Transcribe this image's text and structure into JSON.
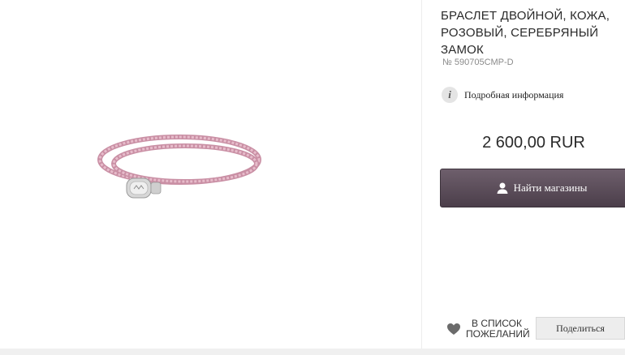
{
  "product": {
    "title": "БРАСЛЕТ ДВОЙНОЙ, КОЖА, РОЗОВЫЙ, СЕРЕБРЯНЫЙ ЗАМОК",
    "sku": "№ 590705CMP-D",
    "image_icon": "pink-double-leather-bracelet"
  },
  "details": {
    "icon": "info-icon",
    "icon_glyph": "i",
    "label": "Подробная информация"
  },
  "price": {
    "text": "2 600,00 RUR"
  },
  "find_stores": {
    "icon": "person-icon",
    "label": "Найти магазины"
  },
  "wishlist": {
    "icon": "heart-icon",
    "label": "В СПИСОК ПОЖЕЛАНИЙ"
  },
  "share": {
    "label": "Поделиться"
  },
  "colors": {
    "button_dark": "#5a4b58",
    "bracelet_pink": "#d9a3b5",
    "clasp_silver": "#c9c9c9"
  }
}
